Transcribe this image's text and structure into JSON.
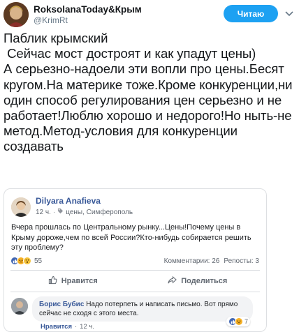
{
  "tweet": {
    "author_name": "RoksolanaToday&Крым",
    "author_handle": "@KrimRt",
    "follow_label": "Читаю",
    "text": "Паблик крымский\n Сейчас мост достроят и как упадут цены)\nА серьезно-надоели эти вопли про цены.Бесят кругом.На материке тоже.Кроме конкуренции,ни один способ регулирования цен серьезно и не работает!Люблю хорошо и недорого!Но ныть-не метод.Метод-условия для конкуренции создавать"
  },
  "fb_post": {
    "author": "Dilyara Anafieva",
    "time": "12 ч.",
    "tag": "цены, Симферополь",
    "body": "Вчера прошлась по Центральному рынку...Цены!Почему цены в Крыму дороже,чем по всей России?Кто-нибудь собирается решить эту проблему?",
    "reaction_count": "55",
    "comments": "Комментарии: 26",
    "reposts": "Репосты: 3",
    "like_label": "Нравится",
    "share_label": "Поделиться",
    "comment": {
      "author": "Борис Бубис",
      "text": "Надо потерпеть и написать письмо. Вот прямо сейчас не сходя с этого места.",
      "like_label": "Нравится",
      "time": "12 ч.",
      "reaction_count": "7"
    }
  },
  "colors": {
    "twitter_blue": "#1da1f2",
    "fb_blue": "#385898",
    "fb_like_blue": "#4267b2"
  }
}
